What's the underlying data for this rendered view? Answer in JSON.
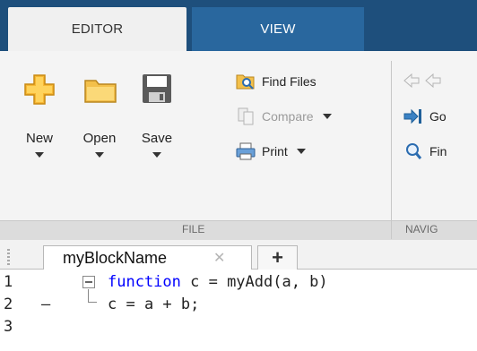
{
  "toolstrip": {
    "tabs": [
      {
        "label": "EDITOR",
        "active": true
      },
      {
        "label": "VIEW",
        "active": false
      }
    ],
    "file_group": {
      "label": "FILE",
      "buttons": {
        "new": "New",
        "open": "Open",
        "save": "Save",
        "find_files": "Find Files",
        "compare": "Compare",
        "print": "Print"
      }
    },
    "nav_group": {
      "label": "NAVIG",
      "goto": "Go",
      "find": "Fin"
    }
  },
  "document": {
    "tab_label": "myBlockName",
    "close_glyph": "✕",
    "new_tab_glyph": "+"
  },
  "code": {
    "lines": [
      {
        "number": "1",
        "marker": "",
        "keyword": "function",
        "text": " c = myAdd(a, b)"
      },
      {
        "number": "2",
        "marker": "–",
        "keyword": "",
        "text": "c = a + b;"
      },
      {
        "number": "3",
        "marker": "",
        "keyword": "",
        "text": ""
      }
    ]
  },
  "colors": {
    "tabstrip": "#1e4f7c",
    "keyword": "#0000ff",
    "folder": "#f0b429",
    "new_plus": "#f5a623"
  },
  "icons": [
    "new-file-plus-icon",
    "open-folder-icon",
    "save-disk-icon",
    "find-files-icon",
    "compare-icon",
    "print-icon",
    "back-arrow-icon",
    "goto-icon",
    "find-magnifier-icon",
    "fold-collapse-icon"
  ]
}
